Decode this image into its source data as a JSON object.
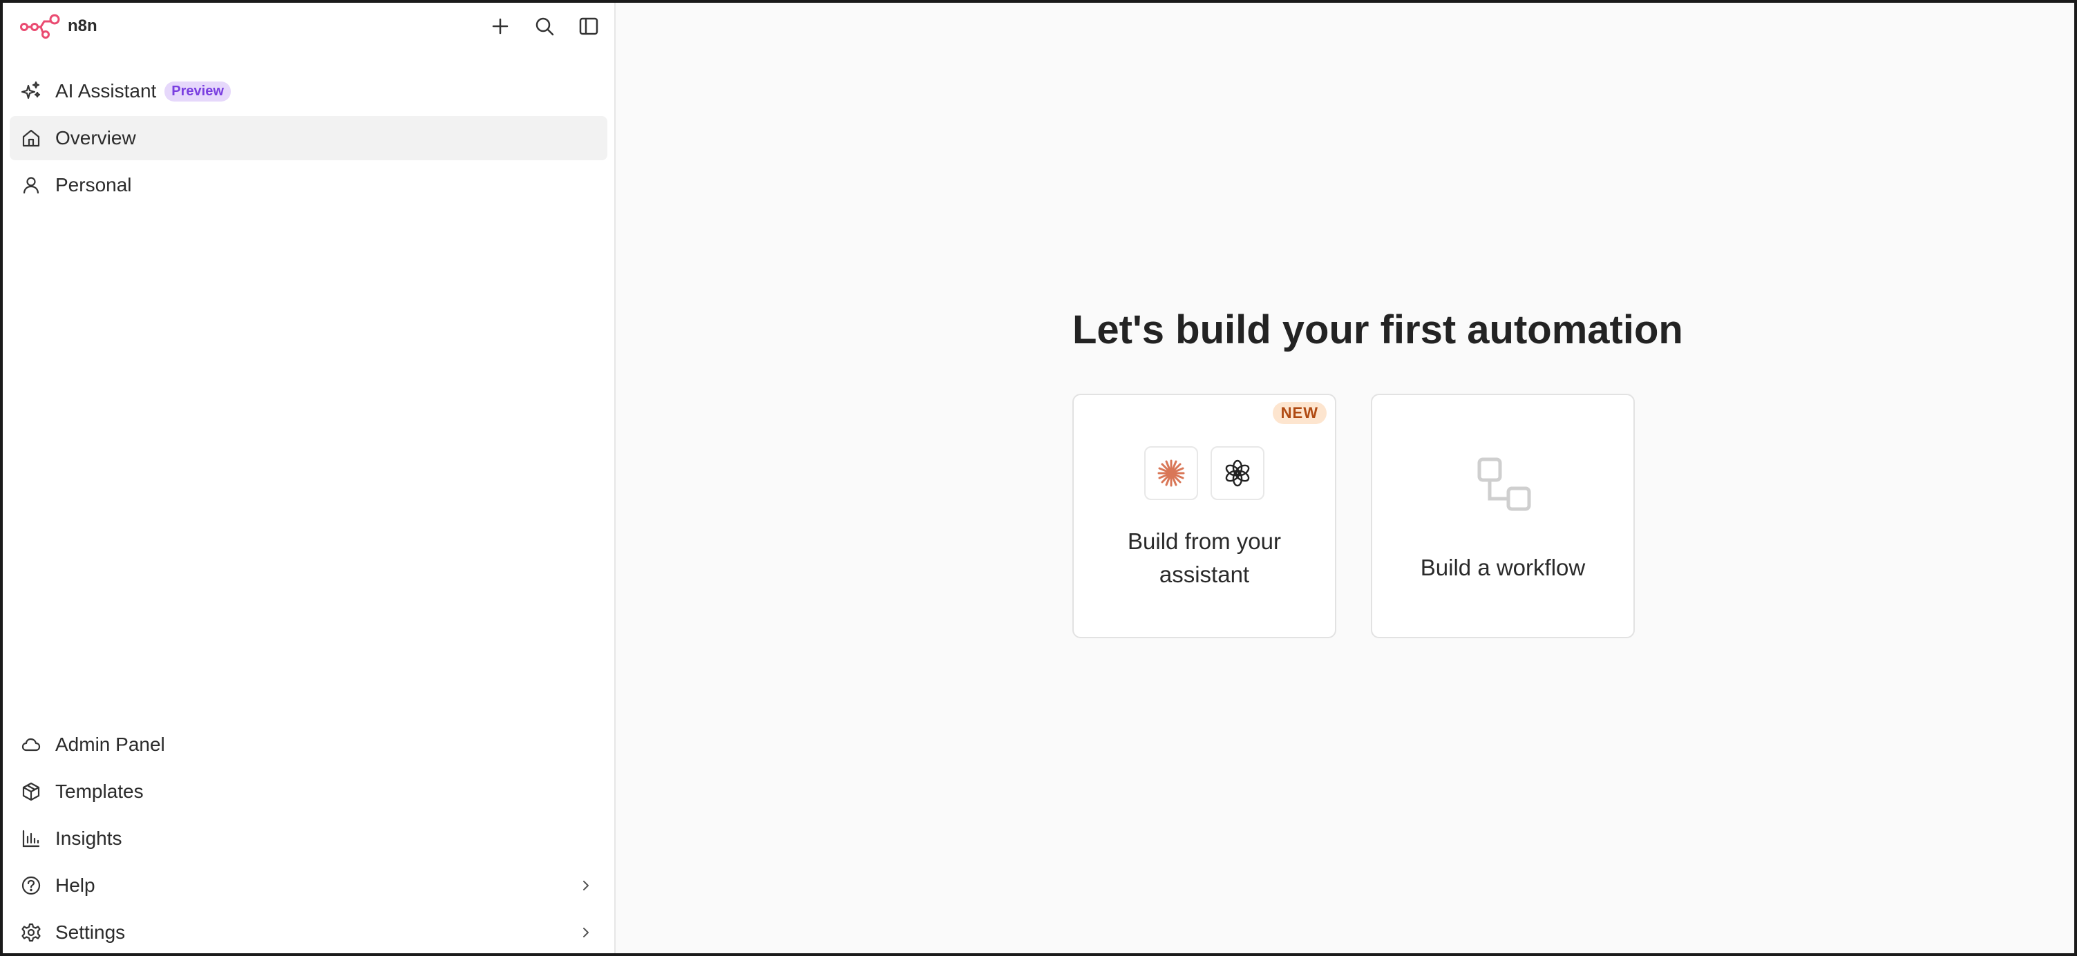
{
  "app": {
    "name": "n8n"
  },
  "sidebar": {
    "top_items": [
      {
        "label": "AI Assistant",
        "badge": "Preview",
        "icon": "sparkles-icon"
      },
      {
        "label": "Overview",
        "icon": "home-icon",
        "active": true
      },
      {
        "label": "Personal",
        "icon": "user-icon"
      }
    ],
    "bottom_items": [
      {
        "label": "Admin Panel",
        "icon": "cloud-icon"
      },
      {
        "label": "Templates",
        "icon": "box-icon"
      },
      {
        "label": "Insights",
        "icon": "bar-chart-icon"
      },
      {
        "label": "Help",
        "icon": "help-circle-icon"
      },
      {
        "label": "Settings",
        "icon": "gear-icon"
      }
    ]
  },
  "main": {
    "heading": "Let's build your first automation",
    "cards": [
      {
        "title_line1": "Build from your",
        "title_line2": "assistant",
        "badge": "NEW"
      },
      {
        "title": "Build a workflow"
      }
    ]
  },
  "colors": {
    "brand": "#ea4b71",
    "preview_badge_bg": "#e6d8fb",
    "preview_badge_text": "#7a3fe0",
    "new_badge_bg": "#fde5cf",
    "new_badge_text": "#b04a12",
    "claude_orange": "#d97757"
  }
}
